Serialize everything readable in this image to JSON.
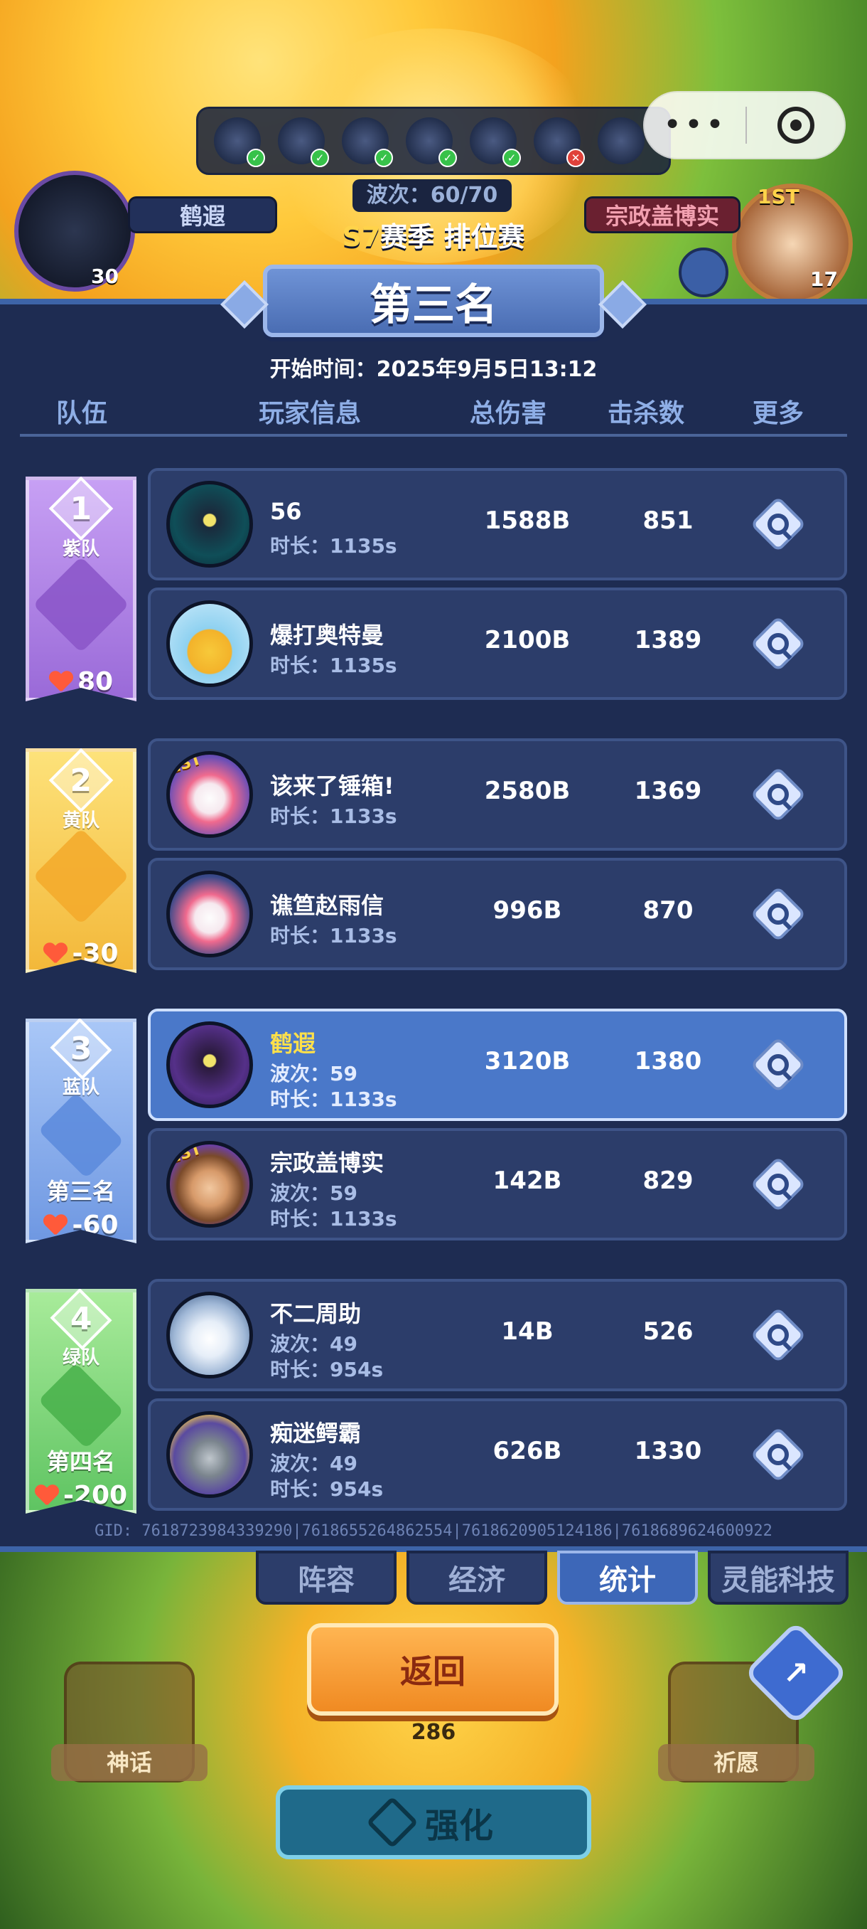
{
  "hud": {
    "heroes": [
      {
        "icon": "hero-bomb-icon",
        "status": "check"
      },
      {
        "icon": "hero-beetle-icon",
        "status": "check"
      },
      {
        "icon": "hero-snowflake-icon",
        "status": "check"
      },
      {
        "icon": "hero-spider-icon",
        "status": "check"
      },
      {
        "icon": "hero-duck-icon",
        "status": "check"
      },
      {
        "icon": "hero-moon-icon",
        "status": "x"
      },
      {
        "icon": "hero-dragon-icon",
        "status": "none"
      }
    ],
    "left_player": {
      "name": "鹤遐",
      "level": "30"
    },
    "right_player": {
      "name": "宗政盖博实",
      "level": "17",
      "badge": "1ST"
    },
    "wave": "波次：60/70",
    "season_prefix": "S7",
    "season_rest": "赛季 排位赛"
  },
  "title": "第三名",
  "start_time": "开始时间：2025年9月5日13:12",
  "columns": {
    "team": "队伍",
    "player": "玩家信息",
    "damage": "总伤害",
    "kills": "击杀数",
    "more": "更多"
  },
  "teams": [
    {
      "number": "1",
      "name": "紫队",
      "rank_label": "",
      "hp": "80",
      "color": "#b58be8"
    },
    {
      "number": "2",
      "name": "黄队",
      "rank_label": "",
      "hp": "-30",
      "color": "#f6cd57"
    },
    {
      "number": "3",
      "name": "蓝队",
      "rank_label": "第三名",
      "hp": "-60",
      "color": "#8eb2ee"
    },
    {
      "number": "4",
      "name": "绿队",
      "rank_label": "第四名",
      "hp": "-200",
      "color": "#86d97e"
    }
  ],
  "players": [
    {
      "name": "56",
      "wave": "",
      "duration": "时长：1135s",
      "damage": "1588B",
      "kills": "851",
      "highlight": false
    },
    {
      "name": "爆打奥特曼",
      "wave": "",
      "duration": "时长：1135s",
      "damage": "2100B",
      "kills": "1389",
      "highlight": false
    },
    {
      "name": "该来了锤箱!",
      "wave": "",
      "duration": "时长：1133s",
      "damage": "2580B",
      "kills": "1369",
      "highlight": false
    },
    {
      "name": "谯笪赵雨信",
      "wave": "",
      "duration": "时长：1133s",
      "damage": "996B",
      "kills": "870",
      "highlight": false
    },
    {
      "name": "鹤遐",
      "wave": "波次：59",
      "duration": "时长：1133s",
      "damage": "3120B",
      "kills": "1380",
      "highlight": true
    },
    {
      "name": "宗政盖博实",
      "wave": "波次：59",
      "duration": "时长：1133s",
      "damage": "142B",
      "kills": "829",
      "highlight": false
    },
    {
      "name": "不二周助",
      "wave": "波次：49",
      "duration": "时长：954s",
      "damage": "14B",
      "kills": "526",
      "highlight": false
    },
    {
      "name": "痴迷鳄霸",
      "wave": "波次：49",
      "duration": "时长：954s",
      "damage": "626B",
      "kills": "1330",
      "highlight": false
    }
  ],
  "gid": "GID: 7618723984339290|7618655264862554|7618620905124186|7618689624600922",
  "tabs": [
    "阵容",
    "经济",
    "统计",
    "灵能科技"
  ],
  "active_tab": "统计",
  "return_label": "返回",
  "bottom": {
    "left_label": "神话",
    "right_label": "祈愿",
    "coins": "286",
    "enhance_label": "强化"
  }
}
